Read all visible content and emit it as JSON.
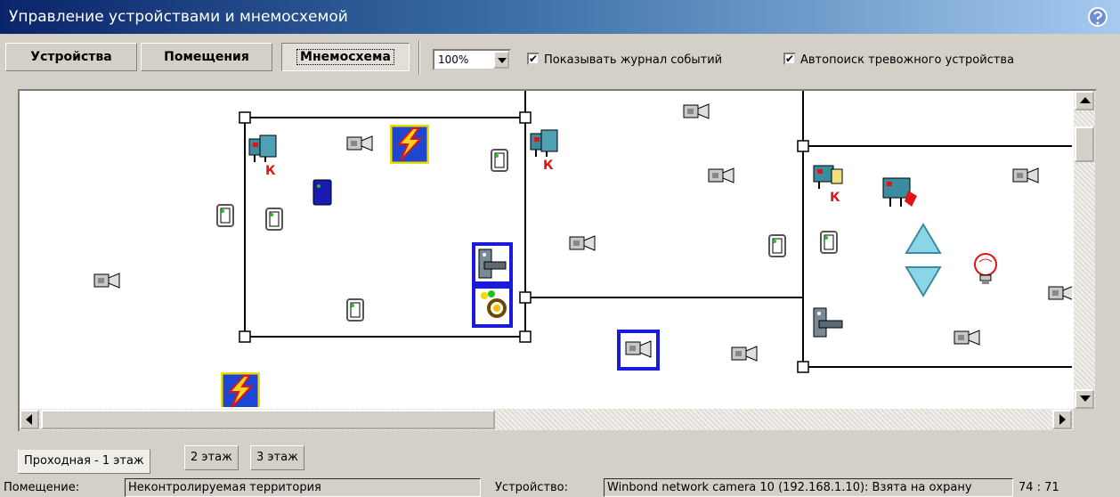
{
  "window": {
    "title": "Управление устройствами и мнемосхемой"
  },
  "toolbar": {
    "tabs": [
      "Устройства",
      "Помещения",
      "Мнемосхема"
    ],
    "zoom": "100%",
    "show_log_label": "Показывать журнал событий",
    "show_log_checked": true,
    "autosearch_label": "Автопоиск тревожного устройства",
    "autosearch_checked": true
  },
  "scene": {
    "badge_letter": "К"
  },
  "floor_tabs": [
    "Проходная - 1 этаж",
    "2 этаж",
    "3 этаж"
  ],
  "status": {
    "room_label": "Помещение:",
    "room_value": "Неконтролируемая территория",
    "device_label": "Устройство:",
    "device_value": "Winbond network camera 10 (192.168.1.10): Взята на охрану",
    "coords": "74 : 71"
  }
}
